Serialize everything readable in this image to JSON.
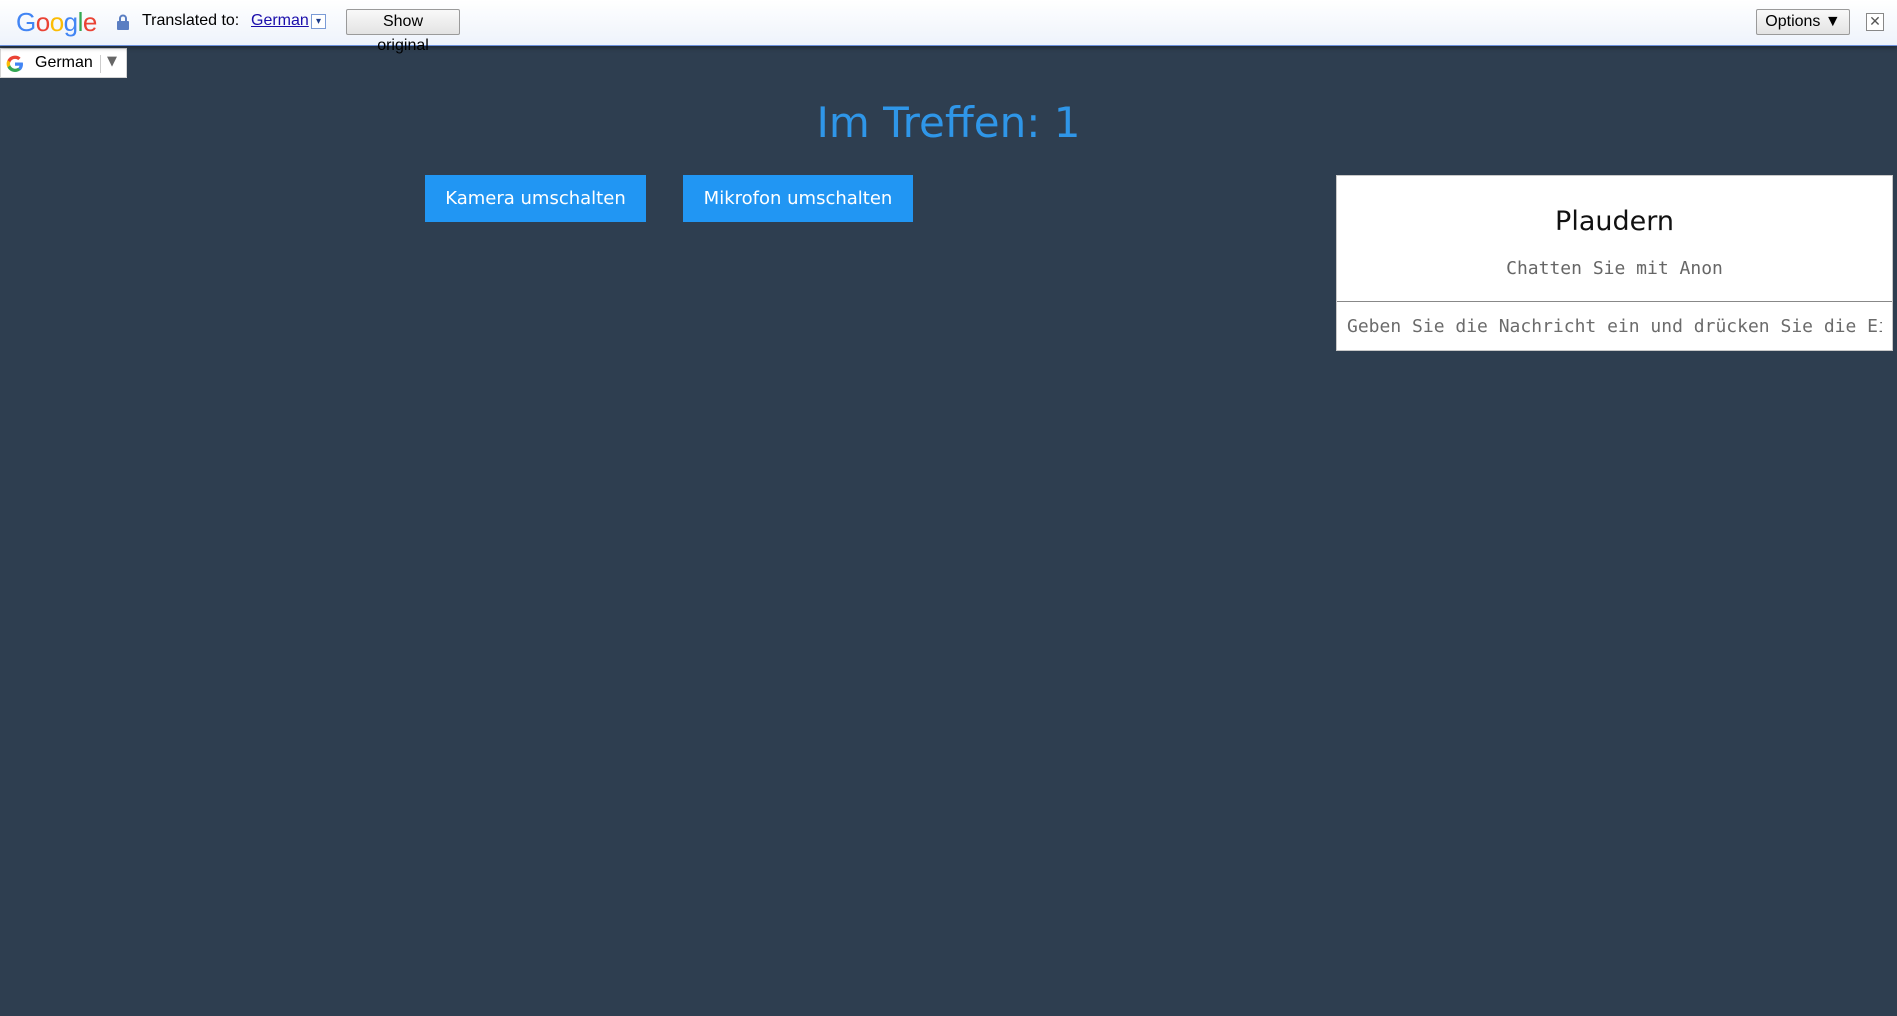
{
  "translate_bar": {
    "logo_letters": [
      "G",
      "o",
      "o",
      "g",
      "l",
      "e"
    ],
    "logo_colors": [
      "#4285f4",
      "#ea4335",
      "#fbbc05",
      "#4285f4",
      "#34a853",
      "#ea4335"
    ],
    "translated_to_label": "Translated to:",
    "language_link": "German",
    "language_dropdown_icon": "dropdown-arrow-icon",
    "show_original_label": "Show original",
    "options_label": "Options ▼",
    "close_icon": "close-icon",
    "close_symbol": "✕"
  },
  "language_widget": {
    "label": "German",
    "arrow": "▼",
    "icon": "google-g-icon"
  },
  "meeting": {
    "title": "Im Treffen: 1",
    "title_color": "#2f96e8",
    "background_color": "#2e3e50"
  },
  "controls": {
    "camera_toggle_label": "Kamera umschalten",
    "mic_toggle_label": "Mikrofon umschalten",
    "button_color": "#2196f3"
  },
  "chat": {
    "title": "Plaudern",
    "subtitle": "Chatten Sie mit Anon",
    "input_placeholder": "Geben Sie die Nachricht ein und drücken Sie die Eingabetaste"
  }
}
